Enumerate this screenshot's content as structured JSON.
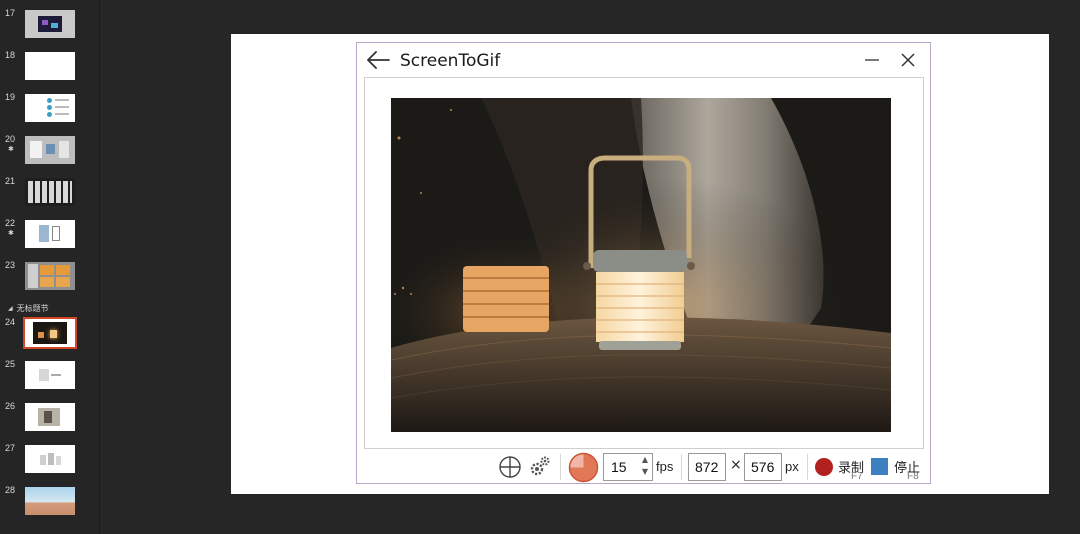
{
  "slides": [
    {
      "number": "17",
      "star": false,
      "thumb": "dark-collage"
    },
    {
      "number": "18",
      "star": false,
      "thumb": "blank"
    },
    {
      "number": "19",
      "star": false,
      "thumb": "dots"
    },
    {
      "number": "20",
      "star": true,
      "thumb": "gray-layout"
    },
    {
      "number": "21",
      "star": false,
      "thumb": "dark-grid"
    },
    {
      "number": "22",
      "star": true,
      "thumb": "device"
    },
    {
      "number": "23",
      "star": false,
      "thumb": "orange-panels"
    },
    {
      "number": "24",
      "star": false,
      "thumb": "lamp",
      "selected": true
    },
    {
      "number": "25",
      "star": false,
      "thumb": "product-white"
    },
    {
      "number": "26",
      "star": false,
      "thumb": "interior"
    },
    {
      "number": "27",
      "star": false,
      "thumb": "small-objects"
    },
    {
      "number": "28",
      "star": false,
      "thumb": "landscape"
    }
  ],
  "section": {
    "label": "无标题节",
    "arrow": "◢"
  },
  "window": {
    "title": "ScreenToGif",
    "back_icon": "arrow-left-icon",
    "minimize_icon": "minimize-icon",
    "close_icon": "close-icon"
  },
  "toolbar": {
    "fps_value": "15",
    "fps_label": "fps",
    "spin_up": "▲",
    "spin_down": "▼",
    "width": "872",
    "times": "×",
    "height": "576",
    "px_label": "px",
    "record_label": "录制",
    "record_key": "F7",
    "stop_label": "停止",
    "stop_key": "F8"
  },
  "colors": {
    "accent_record": "#b3211e",
    "accent_stop": "#3d7fc1",
    "selection": "#d24726",
    "window_border": "#b9a7c9"
  }
}
